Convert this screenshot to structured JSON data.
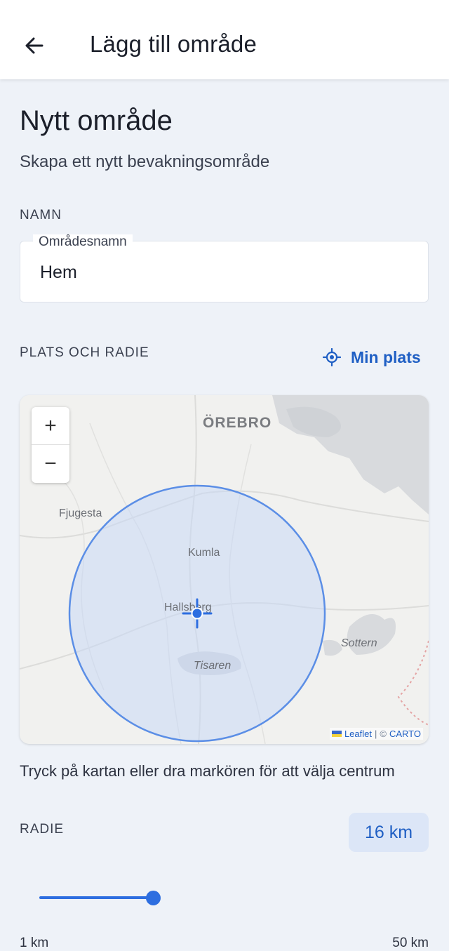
{
  "appbar": {
    "title": "Lägg till område"
  },
  "page": {
    "title": "Nytt område",
    "subtitle": "Skapa ett nytt bevakningsområde"
  },
  "name_section": {
    "label": "NAMN",
    "field_label": "Områdesnamn",
    "field_value": "Hem"
  },
  "location_section": {
    "label": "PLATS OCH RADIE",
    "my_location_label": "Min plats"
  },
  "map": {
    "zoom_in": "+",
    "zoom_out": "−",
    "places": {
      "orebro": "ÖREBRO",
      "fjugesta": "Fjugesta",
      "kumla": "Kumla",
      "hallsberg": "Hallsberg",
      "sottern": "Sottern",
      "tisaren": "Tisaren"
    },
    "attribution": {
      "leaflet": "Leaflet",
      "separator": "|",
      "copyright": "©",
      "carto": "CARTO"
    }
  },
  "hint": "Tryck på kartan eller dra markören för att välja centrum",
  "radius": {
    "label": "RADIE",
    "value_label": "16 km",
    "value_km": 16,
    "min_km": 1,
    "max_km": 50,
    "min_label": "1 km",
    "max_label": "50 km",
    "slider_position_fraction": 0.306
  },
  "colors": {
    "accent": "#2d6ee0",
    "link": "#1f5fc4",
    "badge_bg": "#dce6f7",
    "background": "#eef2f8",
    "radius_fill": "#c9d8f6",
    "radius_stroke": "#5b8ee6"
  },
  "icons": {
    "back": "arrow-left-icon",
    "my_location": "crosshair-location-icon",
    "marker": "crosshair-marker-icon"
  }
}
